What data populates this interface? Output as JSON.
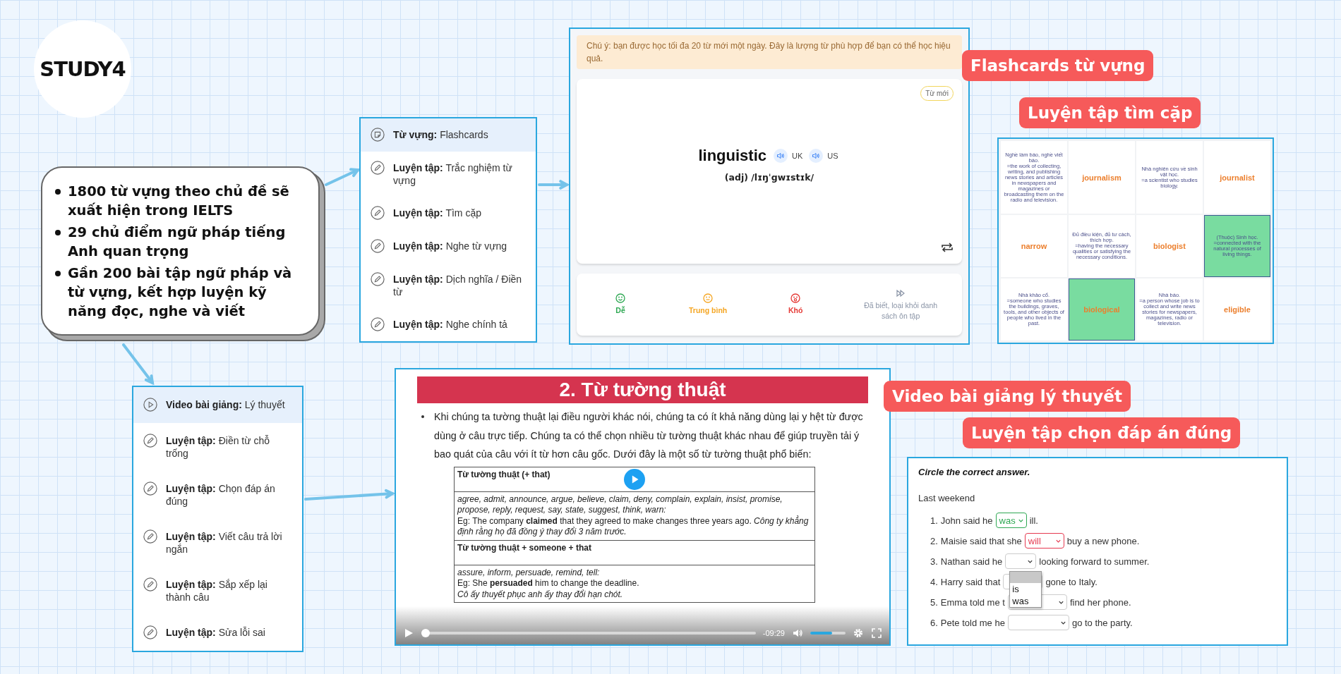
{
  "logo": {
    "text": "STUDY4"
  },
  "features": [
    "1800 từ vựng theo chủ đề sẽ xuất hiện trong IELTS",
    "29 chủ điểm ngữ pháp tiếng Anh quan trọng",
    "Gần 200 bài tập ngữ pháp và từ vựng, kết hợp luyện kỹ năng đọc, nghe và viết"
  ],
  "vocab_menu": {
    "items": [
      {
        "kind": "flashcard",
        "label": "Từ vựng:",
        "title": "Flashcards",
        "selected": true
      },
      {
        "kind": "practice",
        "label": "Luyện tập:",
        "title": "Trắc nghiệm từ vựng",
        "selected": false
      },
      {
        "kind": "practice",
        "label": "Luyện tập:",
        "title": "Tìm cặp",
        "selected": false
      },
      {
        "kind": "practice",
        "label": "Luyện tập:",
        "title": "Nghe từ vựng",
        "selected": false
      },
      {
        "kind": "practice",
        "label": "Luyện tập:",
        "title": "Dịch nghĩa / Điền từ",
        "selected": false
      },
      {
        "kind": "practice",
        "label": "Luyện tập:",
        "title": "Nghe chính tả",
        "selected": false
      }
    ]
  },
  "flashcard": {
    "caption": "Flashcards từ vựng",
    "notice": "Chú ý: bạn được học tối đa 20 từ mới một ngày. Đây là lượng từ phù hợp để bạn có thể học hiệu quả.",
    "badge": "Từ mới",
    "word": "linguistic",
    "audio": [
      {
        "label": "UK"
      },
      {
        "label": "US"
      }
    ],
    "phonetic": "(adj) /lɪŋˈgwɪstɪk/",
    "ratings": [
      {
        "kind": "easy",
        "label": "Dễ",
        "color": "#2ea853"
      },
      {
        "kind": "medium",
        "label": "Trung bình",
        "color": "#f5a623"
      },
      {
        "kind": "hard",
        "label": "Khó",
        "color": "#e53935"
      },
      {
        "kind": "skip",
        "label": "Đã biết, loại khỏi danh sách ôn tập",
        "color": "#8a94a6"
      }
    ]
  },
  "matching": {
    "caption": "Luyện tập tìm cặp",
    "cards": [
      {
        "kind": "definition",
        "text": "Nghề làm báo, nghề viết báo.\n=the work of collecting, writing, and publishing news stories and articles in newspapers and magazines or broadcasting them on the radio and television.",
        "matched": false
      },
      {
        "kind": "word",
        "text": "journalism",
        "matched": false
      },
      {
        "kind": "definition",
        "text": "Nhà nghiên cứu về sinh vật học.\n=a scientist who studies biology.",
        "matched": false
      },
      {
        "kind": "word",
        "text": "journalist",
        "matched": false
      },
      {
        "kind": "word",
        "text": "narrow",
        "matched": false
      },
      {
        "kind": "definition",
        "text": "Đủ điều kiện, đủ tư cách, thích hợp.\n=having the necessary qualities or satisfying the necessary conditions.",
        "matched": false
      },
      {
        "kind": "word",
        "text": "biologist",
        "matched": false
      },
      {
        "kind": "definition",
        "text": "(Thuộc) Sinh học.\n=connected with the natural processes of living things.",
        "matched": true
      },
      {
        "kind": "definition",
        "text": "Nhà khảo cổ.\n=someone who studies the buildings, graves, tools, and other objects of people who lived in the past.",
        "matched": false
      },
      {
        "kind": "word",
        "text": "biological",
        "matched": true
      },
      {
        "kind": "definition",
        "text": "Nhà báo.\n=a person whose job is to collect and write news stories for newspapers, magazines, radio or television.",
        "matched": false
      },
      {
        "kind": "word",
        "text": "eligible",
        "matched": false
      }
    ]
  },
  "grammar_menu": {
    "items": [
      {
        "kind": "video",
        "label": "Video bài giảng:",
        "title": "Lý thuyết",
        "selected": true
      },
      {
        "kind": "practice",
        "label": "Luyện tập:",
        "title": "Điền từ chỗ trống",
        "selected": false
      },
      {
        "kind": "practice",
        "label": "Luyện tập:",
        "title": "Chọn đáp án đúng",
        "selected": false
      },
      {
        "kind": "practice",
        "label": "Luyện tập:",
        "title": "Viết câu trả lời ngắn",
        "selected": false
      },
      {
        "kind": "practice",
        "label": "Luyện tập:",
        "title": "Sắp xếp lại thành câu",
        "selected": false
      },
      {
        "kind": "practice",
        "label": "Luyện tập:",
        "title": "Sửa lỗi sai",
        "selected": false
      }
    ]
  },
  "video": {
    "caption": "Video bài giảng lý thuyết",
    "title": "2. Từ tường thuật",
    "bullet": "Khi chúng ta tường thuật lại điều người khác nói, chúng ta có ít khả năng dùng lại y hệt từ được dùng ở câu trực tiếp. Chúng ta có thể chọn nhiều từ tường thuật khác nhau để giúp truyền tải ý bao quát của câu với ít từ hơn câu gốc. Dưới đây là một số từ tường thuật phổ biến:",
    "table": [
      {
        "heading": "Từ tường thuật (+ that)",
        "words": "agree, admit, announce, argue, believe, claim, deny, complain, explain, insist, promise, propose, reply, request, say, state, suggest, think, warn:",
        "example": "Eg:  The company **claimed** that they agreed to make changes three years ago.  *Công ty khẳng định rằng họ đã đồng ý thay đổi 3 năm trước.*"
      },
      {
        "heading": "Từ tường thuật + someone + that",
        "words": "assure, inform, persuade, remind, tell:",
        "example": "Eg: She **persuaded** him to change the deadline.",
        "translation": "Cô ấy thuyết phục anh ấy thay đổi hạn chót."
      }
    ],
    "progress": {
      "level": 0.0
    },
    "time": "-09:29",
    "volume": {
      "level": 0.62
    }
  },
  "exercise": {
    "caption": "Luyện tập chọn đáp án đúng",
    "instruction": "Circle the correct answer.",
    "intro": "Last weekend",
    "questions": [
      {
        "number": "1.",
        "before": "John said he",
        "answer": "was",
        "kind": "correct",
        "after": "ill."
      },
      {
        "number": "2.",
        "before": "Maisie said that she",
        "answer": "will",
        "kind": "wrong",
        "after": "buy a new phone."
      },
      {
        "number": "3.",
        "before": "Nathan said he",
        "kind": "open",
        "options": [
          "is",
          "was"
        ],
        "after": "looking forward to summer."
      },
      {
        "number": "4.",
        "before": "Harry said that",
        "kind": "empty",
        "after": "gone to Italy."
      },
      {
        "number": "5.",
        "before": "Emma told me t",
        "kind": "empty",
        "after": "find her phone."
      },
      {
        "number": "6.",
        "before": "Pete told me he",
        "kind": "empty",
        "after": "go to the party."
      }
    ]
  }
}
